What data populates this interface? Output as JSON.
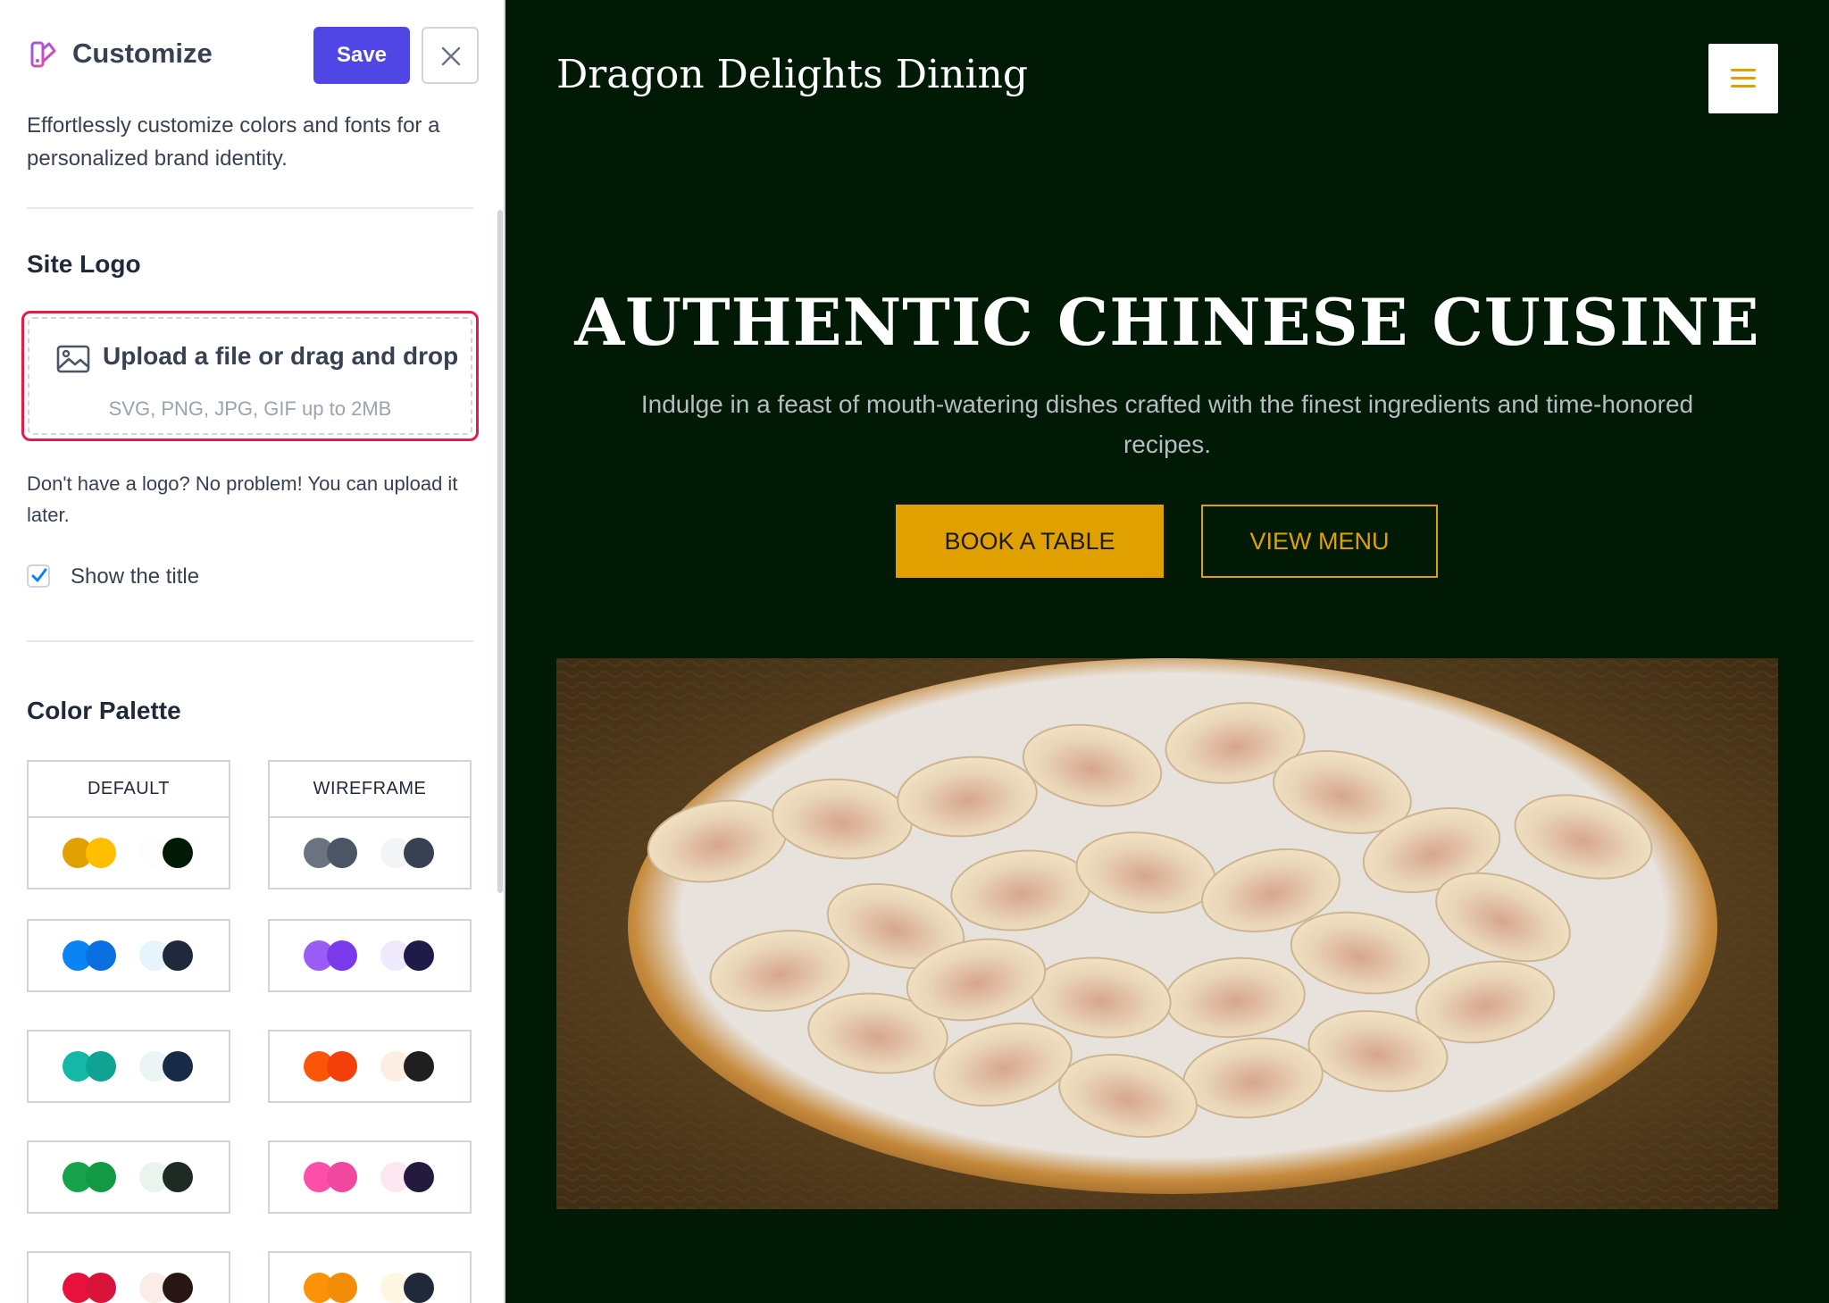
{
  "panel": {
    "title": "Customize",
    "save_label": "Save",
    "description": "Effortlessly customize colors and fonts for a personalized brand identity.",
    "site_logo": {
      "heading": "Site Logo",
      "upload_label": "Upload a file or drag and drop",
      "upload_hint": "SVG, PNG, JPG, GIF up to 2MB",
      "note": "Don't have a logo? No problem! You can upload it later.",
      "show_title_label": "Show the title",
      "show_title_checked": true
    },
    "color_palette": {
      "heading": "Color Palette",
      "palettes": [
        {
          "name": "DEFAULT",
          "colors": [
            "#e0a100",
            "#ffbe00",
            "#fdfdfd",
            "#001a06"
          ]
        },
        {
          "name": "WIREFRAME",
          "colors": [
            "#6b7280",
            "#4b5563",
            "#f3f4f6",
            "#374151"
          ]
        },
        {
          "name": "",
          "colors": [
            "#0b84f3",
            "#0a6fe0",
            "#e6f4fd",
            "#1e293b"
          ]
        },
        {
          "name": "",
          "colors": [
            "#9a5cf5",
            "#7c3aed",
            "#efe9fd",
            "#1e1b4b"
          ]
        },
        {
          "name": "",
          "colors": [
            "#14b8a6",
            "#0fa394",
            "#ebf5f3",
            "#172a46"
          ]
        },
        {
          "name": "",
          "colors": [
            "#fb5607",
            "#f43f0a",
            "#fdeee2",
            "#1f1f1f"
          ]
        },
        {
          "name": "",
          "colors": [
            "#16a34a",
            "#119944",
            "#eaf3ee",
            "#1d2b24"
          ]
        },
        {
          "name": "",
          "colors": [
            "#fb4fa8",
            "#f0479f",
            "#fde8f1",
            "#231a3d"
          ]
        },
        {
          "name": "",
          "colors": [
            "#e8113c",
            "#d9133a",
            "#fbece8",
            "#2a1515"
          ]
        },
        {
          "name": "",
          "colors": [
            "#fb9207",
            "#f38c06",
            "#fdf7e2",
            "#1f2937"
          ]
        }
      ]
    }
  },
  "preview": {
    "site_name": "Dragon Delights Dining",
    "hero_title": "AUTHENTIC CHINESE CUISINE",
    "hero_subtitle": "Indulge in a feast of mouth-watering dishes crafted with the finest ingredients and time-honored recipes.",
    "primary_cta": "BOOK A TABLE",
    "secondary_cta": "VIEW MENU",
    "accent_color": "#e0a100",
    "background_color": "#001a06",
    "image_subject": "dumplings-on-bamboo-tray"
  }
}
